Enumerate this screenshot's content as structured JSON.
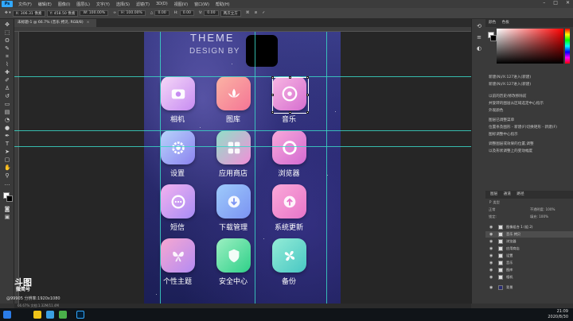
{
  "menubar": {
    "app": "Ps",
    "items": [
      "文件(F)",
      "编辑(E)",
      "图像(I)",
      "图层(L)",
      "文字(Y)",
      "选择(S)",
      "滤镜(T)",
      "3D(D)",
      "视图(V)",
      "窗口(W)",
      "帮助(H)"
    ]
  },
  "options": {
    "x": "X: 306.31 像素",
    "y": "Y: 458.50 像素",
    "w": "W: 100.00%",
    "h": "H: 100.00%",
    "angle": "0.00",
    "h_skew": "0.00",
    "v_skew": "0.00",
    "interp": "两次立方"
  },
  "document_tab": {
    "title": "未标题-1 @ 66.7% (音乐 拷贝, RGB/8)"
  },
  "artboard": {
    "title": "THEME",
    "subtitle": "DESIGN BY"
  },
  "apps": [
    {
      "name": "相机",
      "icon": "camera-icon",
      "c1": "#f6d8f7",
      "c2": "#c78cf2"
    },
    {
      "name": "图库",
      "icon": "lotus-icon",
      "c1": "#fbb3a4",
      "c2": "#f47595"
    },
    {
      "name": "音乐",
      "icon": "music-disc-icon",
      "c1": "#f8b7e2",
      "c2": "#d66ed0"
    },
    {
      "name": "设置",
      "icon": "gear-icon",
      "c1": "#b7d4fb",
      "c2": "#8c83f0"
    },
    {
      "name": "应用商店",
      "icon": "grid-icon",
      "c1": "#8fe0c8",
      "c2": "#f28fd8"
    },
    {
      "name": "浏览器",
      "icon": "ring-icon",
      "c1": "#f8a9d9",
      "c2": "#d36ad2"
    },
    {
      "name": "短信",
      "icon": "message-icon",
      "c1": "#f3b2ef",
      "c2": "#a78cf5"
    },
    {
      "name": "下载管理",
      "icon": "download-icon",
      "c1": "#9ecbfb",
      "c2": "#7b93f2"
    },
    {
      "name": "系统更新",
      "icon": "upload-icon",
      "c1": "#fba9d8",
      "c2": "#e775c9"
    },
    {
      "name": "个性主题",
      "icon": "butterfly-icon",
      "c1": "#f7a8d0",
      "c2": "#b48bf3"
    },
    {
      "name": "安全中心",
      "icon": "shield-icon",
      "c1": "#9cf0c2",
      "c2": "#2fd089"
    },
    {
      "name": "备份",
      "icon": "pinwheel-icon",
      "c1": "#93ecd6",
      "c2": "#48c7c4"
    }
  ],
  "watermark": {
    "logo": "斗图",
    "logo2": "微简号",
    "sub": "@99905  分辨率:1920x1080"
  },
  "status": {
    "text": "66.67%   文档:1.32M/11.4M"
  },
  "color_panel": {
    "tab1": "颜色",
    "tab2": "色板"
  },
  "history": {
    "items": [
      "新建(N)/X:127进入(新建)",
      "新建(N)/X:127进入(新建)",
      "以前的历史/修改移除前",
      "并旋转的图层从区域选定中心指示",
      "外观颜色",
      "图层已调整菜单",
      "位置条及图形 - 新建(F)切换矩形 - 新建(F)",
      "图标调整中心指示",
      "调整图层或效果的位置,调整",
      "以及形状调整上的变动幅度"
    ]
  },
  "layers_panel": {
    "tabs": [
      "图层",
      "通道",
      "路径"
    ],
    "kind": "Ｐ 类型",
    "blend": "正常",
    "opacity": "不透明度: 100%",
    "fill": "填充: 100%",
    "lock": "锁定:",
    "items": [
      {
        "name": "图像组合 1 (组 2)",
        "sel": false
      },
      {
        "name": "音乐 拷贝",
        "sel": true
      },
      {
        "name": "浏览器",
        "sel": false
      },
      {
        "name": "应用商店",
        "sel": false
      },
      {
        "name": "设置",
        "sel": false
      },
      {
        "name": "音乐",
        "sel": false
      },
      {
        "name": "图库",
        "sel": false
      },
      {
        "name": "相机",
        "sel": false
      },
      {
        "name": "背景",
        "sel": false
      }
    ]
  },
  "taskbar": {
    "time": "21:09",
    "date": "2020/8/30"
  }
}
